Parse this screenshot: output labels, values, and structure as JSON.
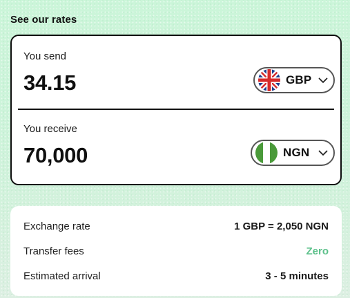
{
  "heading": "See our rates",
  "send": {
    "label": "You send",
    "amount": "34.15",
    "currency": "GBP",
    "flag_icon": "uk-flag-icon"
  },
  "receive": {
    "label": "You receive",
    "amount": "70,000",
    "currency": "NGN",
    "flag_icon": "nigeria-flag-icon"
  },
  "details": [
    {
      "label": "Exchange rate",
      "value": "1 GBP = 2,050 NGN"
    },
    {
      "label": "Transfer fees",
      "value": "Zero"
    },
    {
      "label": "Estimated arrival",
      "value": "3 - 5 minutes"
    }
  ],
  "colors": {
    "background": "#cdf3da",
    "accent_green": "#5bc08a",
    "border": "#0d0d0d"
  }
}
